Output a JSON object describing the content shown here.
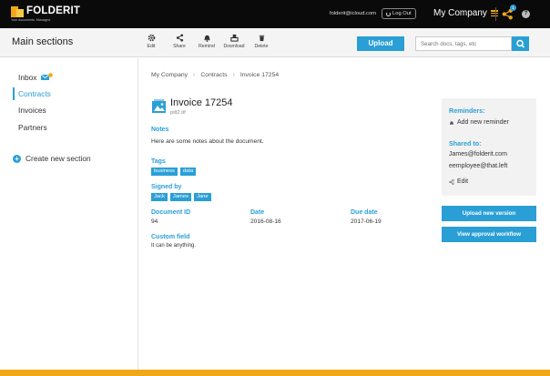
{
  "brand": {
    "name": "FOLDERIT",
    "tagline": "Your documents. Managed."
  },
  "user": {
    "email": "folderit@icloud.com",
    "logout_label": "Log Out",
    "company": "My Company",
    "notification_count": "1",
    "help": "?"
  },
  "toolbar": {
    "title": "Main sections",
    "tools": [
      "Edit",
      "Share",
      "Remind",
      "Download",
      "Delete"
    ],
    "upload_label": "Upload",
    "search_placeholder": "Search docs, tags, etc"
  },
  "sidebar": {
    "items": [
      {
        "label": "Inbox"
      },
      {
        "label": "Contracts"
      },
      {
        "label": "Invoices"
      },
      {
        "label": "Partners"
      }
    ],
    "create_label": "Create new section"
  },
  "breadcrumb": [
    "My Company",
    "Contracts",
    "Invoice 17254"
  ],
  "document": {
    "title": "Invoice 17254",
    "filename": "pilt2.tif",
    "notes_label": "Notes",
    "notes": "Here are some notes about the document.",
    "tags_label": "Tags",
    "tags": [
      "business",
      "data"
    ],
    "signed_label": "Signed by",
    "signers": [
      "Jack",
      "James",
      "Jane"
    ],
    "doc_id_label": "Document ID",
    "doc_id": "94",
    "date_label": "Date",
    "date": "2016-08-16",
    "due_label": "Due date",
    "due": "2017-06-19",
    "custom_label": "Custom field",
    "custom": "It can be anything."
  },
  "panel": {
    "reminders_label": "Reminders:",
    "add_reminder": "Add new reminder",
    "shared_label": "Shared to:",
    "shared": [
      "James@folderit.com",
      "eemployee@that.left"
    ],
    "edit_label": "Edit",
    "upload_version": "Upload new version",
    "approval": "View approval workflow"
  },
  "colors": {
    "accent": "#2a9fd6",
    "brand": "#f0a818",
    "topbar": "#0a0a0a"
  }
}
